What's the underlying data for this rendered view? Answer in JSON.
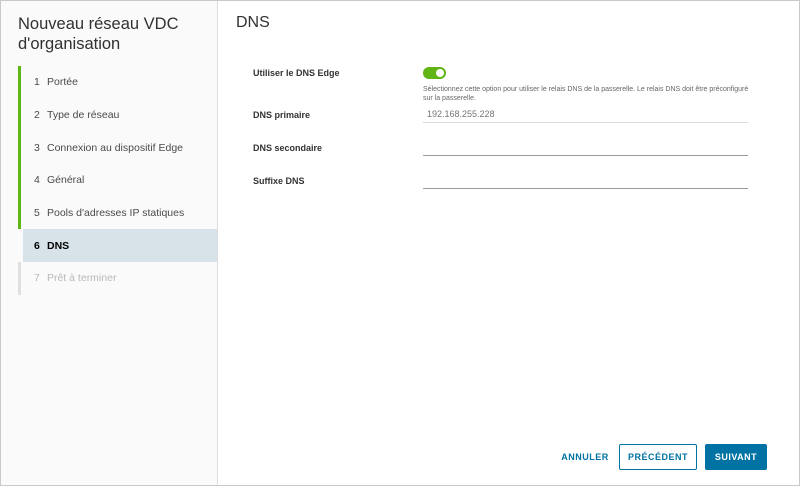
{
  "wizard": {
    "title": "Nouveau réseau VDC d'organisation",
    "steps": [
      {
        "num": "1",
        "label": "Portée",
        "state": "completed"
      },
      {
        "num": "2",
        "label": "Type de réseau",
        "state": "completed"
      },
      {
        "num": "3",
        "label": "Connexion au dispositif Edge",
        "state": "completed"
      },
      {
        "num": "4",
        "label": "Général",
        "state": "completed"
      },
      {
        "num": "5",
        "label": "Pools d'adresses IP statiques",
        "state": "completed"
      },
      {
        "num": "6",
        "label": "DNS",
        "state": "active"
      },
      {
        "num": "7",
        "label": "Prêt à terminer",
        "state": "pending"
      }
    ]
  },
  "page": {
    "title": "DNS",
    "use_edge_dns": {
      "label": "Utiliser le DNS Edge",
      "enabled": true,
      "helper": "Sélectionnez cette option pour utiliser le relais DNS de la passerelle. Le relais DNS doit être préconfiguré sur la passerelle."
    },
    "primary_dns": {
      "label": "DNS primaire",
      "placeholder": "192.168.255.228",
      "value": ""
    },
    "secondary_dns": {
      "label": "DNS secondaire",
      "value": ""
    },
    "dns_suffix": {
      "label": "Suffixe DNS",
      "value": ""
    }
  },
  "footer": {
    "cancel_label": "ANNULER",
    "previous_label": "PRÉCÉDENT",
    "next_label": "SUIVANT"
  },
  "colors": {
    "accent": "#0072a3",
    "success": "#60b515",
    "active_step_bg": "#d8e3e9"
  }
}
